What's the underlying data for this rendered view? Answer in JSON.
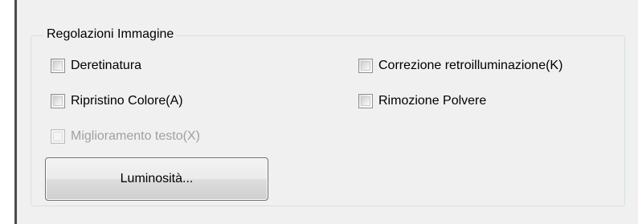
{
  "group": {
    "title": "Regolazioni Immagine"
  },
  "options": {
    "deretinatura": {
      "label": "Deretinatura",
      "checked": false,
      "enabled": true
    },
    "ripristino_colore": {
      "label": "Ripristino Colore(A)",
      "checked": false,
      "enabled": true
    },
    "miglioramento_testo": {
      "label": "Miglioramento testo(X)",
      "checked": false,
      "enabled": false
    },
    "correzione_retroilluminazione": {
      "label": "Correzione retroilluminazione(K)",
      "checked": false,
      "enabled": true
    },
    "rimozione_polvere": {
      "label": "Rimozione Polvere",
      "checked": false,
      "enabled": true
    }
  },
  "buttons": {
    "luminosita_label": "Luminosità..."
  }
}
